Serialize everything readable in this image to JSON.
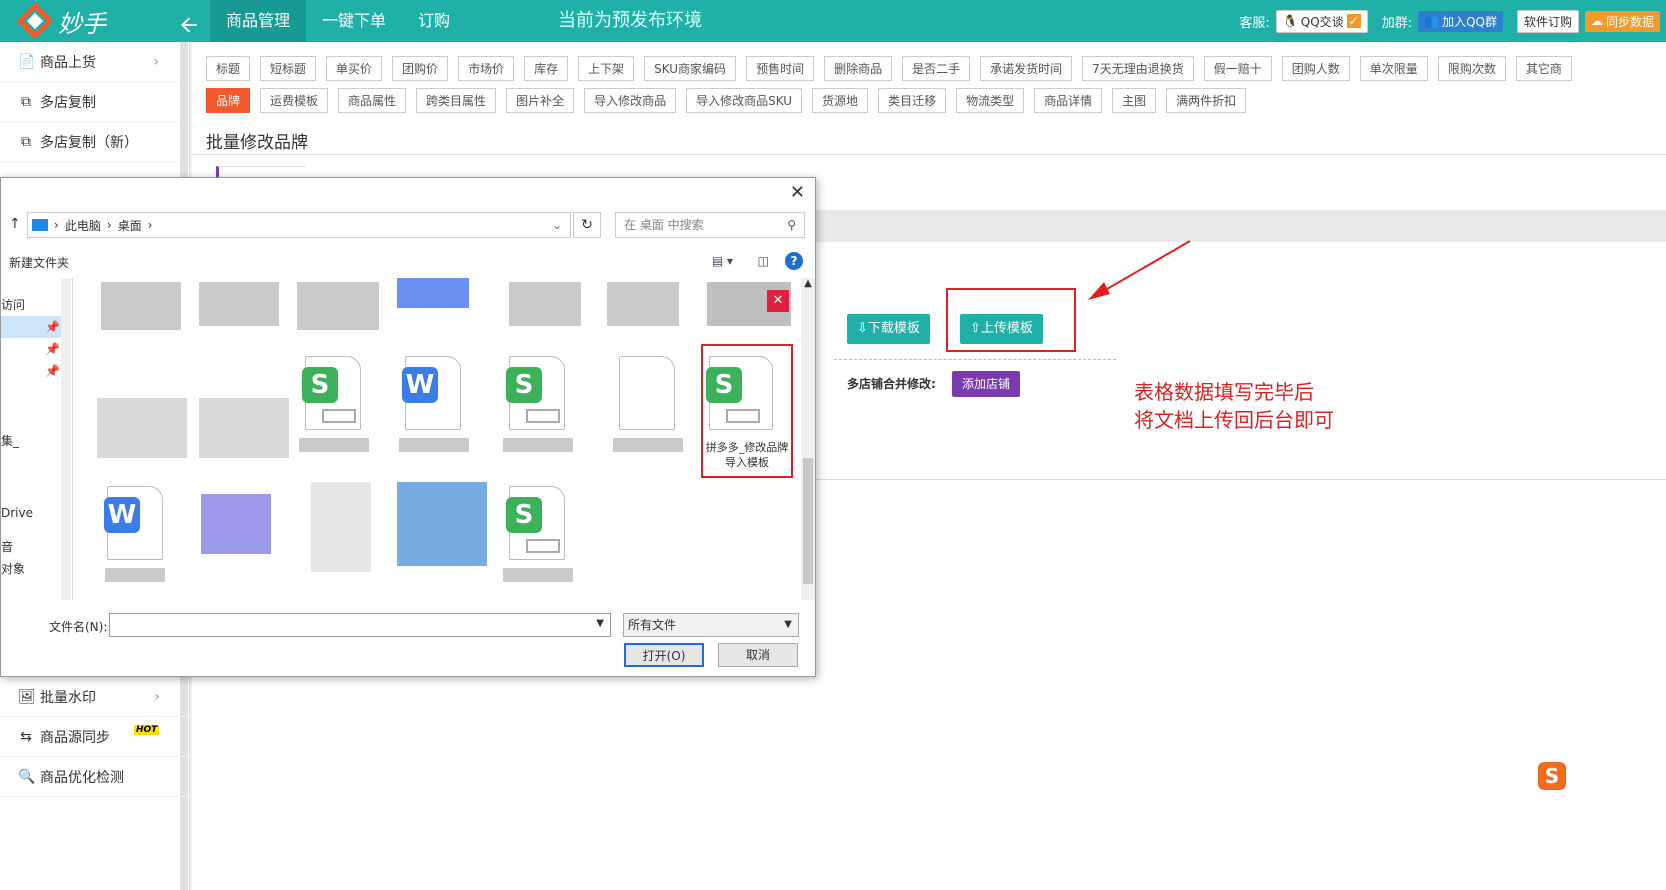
{
  "app": {
    "logo_text": "妙手"
  },
  "nav": {
    "items": [
      {
        "label": "商品管理",
        "active": true
      },
      {
        "label": "一键下单"
      },
      {
        "label": "订购"
      }
    ]
  },
  "env_text": "当前为预发布环境",
  "header_right": {
    "service_label": "客服:",
    "qq_chat": "QQ交谈",
    "group_label": "加群:",
    "join_group": "加入QQ群",
    "order_btn": "软件订购",
    "sync_btn": "同步数据"
  },
  "sidebar": {
    "items_top": [
      {
        "label": "商品上货",
        "icon": "upload-icon",
        "chevron": true
      },
      {
        "label": "多店复制",
        "icon": "copy-icon"
      },
      {
        "label": "多店复制（新）",
        "icon": "copy-icon"
      }
    ],
    "items_bottom": [
      {
        "label": "批量水印",
        "icon": "image-icon",
        "chevron": true
      },
      {
        "label": "商品源同步",
        "icon": "sync-icon",
        "badge": "HOT"
      },
      {
        "label": "商品优化检测",
        "icon": "search-icon"
      }
    ]
  },
  "tags_row1": [
    "标题",
    "短标题",
    "单买价",
    "团购价",
    "市场价",
    "库存",
    "上下架",
    "SKU商家编码",
    "预售时间",
    "删除商品",
    "是否二手",
    "承诺发货时间",
    "7天无理由退换货",
    "假一赔十",
    "团购人数",
    "单次限量",
    "限购次数",
    "其它商"
  ],
  "tags_row2": [
    {
      "label": "品牌",
      "active": true
    },
    {
      "label": "运费模板"
    },
    {
      "label": "商品属性"
    },
    {
      "label": "跨类目属性"
    },
    {
      "label": "图片补全"
    },
    {
      "label": "导入修改商品"
    },
    {
      "label": "导入修改商品SKU"
    },
    {
      "label": "货源地"
    },
    {
      "label": "类目迁移"
    },
    {
      "label": "物流类型"
    },
    {
      "label": "商品详情"
    },
    {
      "label": "主图"
    },
    {
      "label": "满两件折扣"
    }
  ],
  "section_title": "批量修改品牌",
  "panel": {
    "download_btn": "下载模板",
    "upload_btn": "上传模板",
    "merge_label": "多店铺合并修改:",
    "add_shop_btn": "添加店铺"
  },
  "annotation": {
    "line1": "表格数据填写完毕后",
    "line2": "将文档上传回后台即可"
  },
  "dialog": {
    "path": [
      "此电脑",
      "桌面"
    ],
    "search_placeholder": "在 桌面 中搜索",
    "new_folder": "新建文件夹",
    "nav_labels": [
      "访问",
      "集_",
      "Drive",
      "音",
      "对象"
    ],
    "highlight_file": "拼多多_修改品牌导入模板",
    "filename_label": "文件名(N):",
    "filename_value": "",
    "filetype": "所有文件",
    "open_btn": "打开(O)",
    "cancel_btn": "取消"
  },
  "colors": {
    "teal": "#1fb0a8",
    "red": "#e02020",
    "purple": "#7b3bb0",
    "orange_tag": "#f15a2a"
  }
}
